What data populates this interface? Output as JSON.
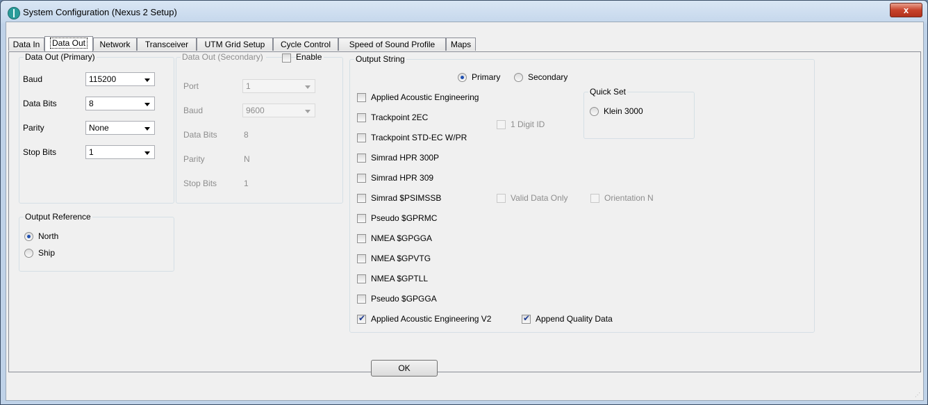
{
  "window": {
    "title": "System Configuration (Nexus 2 Setup)",
    "close_label": "x"
  },
  "tabs": [
    "Data In",
    "Data Out",
    "Network",
    "Transceiver",
    "UTM Grid Setup",
    "Cycle Control",
    "Speed of Sound Profile",
    "Maps"
  ],
  "active_tab": "Data Out",
  "primary": {
    "title": "Data Out (Primary)",
    "baud_label": "Baud",
    "baud_value": "115200",
    "databits_label": "Data Bits",
    "databits_value": "8",
    "parity_label": "Parity",
    "parity_value": "None",
    "stopbits_label": "Stop Bits",
    "stopbits_value": "1"
  },
  "secondary": {
    "title": "Data Out (Secondary)",
    "enable_label": "Enable",
    "port_label": "Port",
    "port_value": "1",
    "baud_label": "Baud",
    "baud_value": "9600",
    "databits_label": "Data Bits",
    "databits_value": "8",
    "parity_label": "Parity",
    "parity_value": "N",
    "stopbits_label": "Stop Bits",
    "stopbits_value": "1"
  },
  "output_reference": {
    "title": "Output Reference",
    "north": "North",
    "ship": "Ship",
    "selected": "North"
  },
  "output_string": {
    "title": "Output String",
    "primary_label": "Primary",
    "secondary_label": "Secondary",
    "selected": "Primary",
    "items": [
      {
        "label": "Applied Acoustic Engineering",
        "checked": false
      },
      {
        "label": "Trackpoint 2EC",
        "checked": false
      },
      {
        "label": "Trackpoint STD-EC W/PR",
        "checked": false
      },
      {
        "label": "Simrad HPR 300P",
        "checked": false
      },
      {
        "label": "Simrad HPR 309",
        "checked": false
      },
      {
        "label": "Simrad $PSIMSSB",
        "checked": false
      },
      {
        "label": "Pseudo $GPRMC",
        "checked": false
      },
      {
        "label": "NMEA $GPGGA",
        "checked": false
      },
      {
        "label": "NMEA $GPVTG",
        "checked": false
      },
      {
        "label": "NMEA $GPTLL",
        "checked": false
      },
      {
        "label": "Pseudo $GPGGA",
        "checked": false
      },
      {
        "label": "Applied Acoustic Engineering V2",
        "checked": true
      }
    ],
    "one_digit_id": "1 Digit ID",
    "valid_data_only": "Valid Data Only",
    "orientation_n": "Orientation N",
    "append_quality": "Append Quality Data"
  },
  "quick_set": {
    "title": "Quick Set",
    "klein": "Klein 3000"
  },
  "ok_label": "OK"
}
